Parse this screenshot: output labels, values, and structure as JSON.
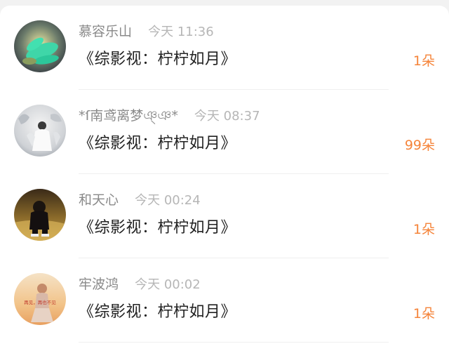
{
  "gift_list": [
    {
      "name": "慕容乐山",
      "time": "今天 11:36",
      "content": "《综影视：柠柠如月》",
      "count": "1朵"
    },
    {
      "name": "*ſ南鸢离梦ঞ্ঞ*",
      "time": "今天 08:37",
      "content": "《综影视：柠柠如月》",
      "count": "99朵"
    },
    {
      "name": "和天心",
      "time": "今天 00:24",
      "content": "《综影视：柠柠如月》",
      "count": "1朵"
    },
    {
      "name": "牢波鸿",
      "time": "今天 00:02",
      "content": "《综影视：柠柠如月》",
      "count": "1朵",
      "avatar_text": "再见，再也不见"
    }
  ],
  "colors": {
    "count": "#f5843a",
    "name": "#8a8a8a",
    "time": "#b6b6b6",
    "content": "#222222"
  }
}
